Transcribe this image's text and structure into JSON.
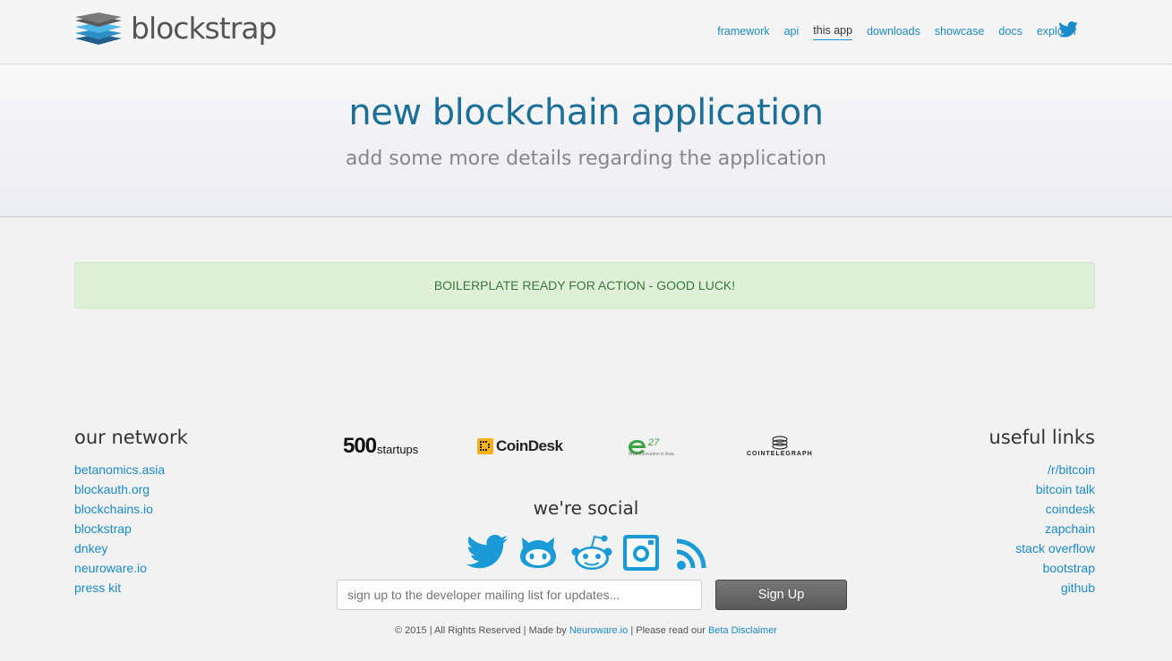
{
  "brand": {
    "name": "blockstrap",
    "logo_icon": "stacked-layers-icon"
  },
  "nav": {
    "items": [
      {
        "label": "framework",
        "active": false
      },
      {
        "label": "api",
        "active": false
      },
      {
        "label": "this app",
        "active": true
      },
      {
        "label": "downloads",
        "active": false
      },
      {
        "label": "showcase",
        "active": false
      },
      {
        "label": "docs",
        "active": false
      },
      {
        "label": "explorer",
        "active": false
      }
    ],
    "twitter_icon": "twitter-icon"
  },
  "hero": {
    "title": "new blockchain application",
    "subtitle": "add some more details regarding the application"
  },
  "alert": {
    "text": "BOILERPLATE READY FOR ACTION - GOOD LUCK!"
  },
  "footer": {
    "our_network": {
      "title": "our network",
      "links": [
        "betanomics.asia",
        "blockauth.org",
        "blockchains.io",
        "blockstrap",
        "dnkey",
        "neuroware.io",
        "press kit"
      ]
    },
    "useful_links": {
      "title": "useful links",
      "links": [
        "/r/bitcoin",
        "bitcoin talk",
        "coindesk",
        "zapchain",
        "stack overflow",
        "bootstrap",
        "github"
      ]
    },
    "partners": {
      "p500_big": "500",
      "p500_small": "startups",
      "coindesk": "CoinDesk",
      "e27_sub": "Web Innovation in Asia",
      "cointelegraph": "COINTELEGRAPH"
    },
    "social": {
      "title": "we're social",
      "icons": [
        "twitter-icon",
        "github-icon",
        "reddit-icon",
        "instagram-icon",
        "rss-icon"
      ]
    },
    "signup": {
      "placeholder": "sign up to the developer mailing list for updates...",
      "button": "Sign Up"
    },
    "copyright": {
      "prefix": "© 2015 | All Rights Reserved | Made by",
      "maker": "Neuroware.io",
      "middle": "| Please read our",
      "disclaimer": "Beta Disclaimer"
    }
  },
  "colors": {
    "link": "#1a8bcc",
    "hero_title": "#1b6f99",
    "alert_bg": "#dff0d8",
    "alert_text": "#3c763d",
    "social_icon": "#1a9ad6"
  }
}
